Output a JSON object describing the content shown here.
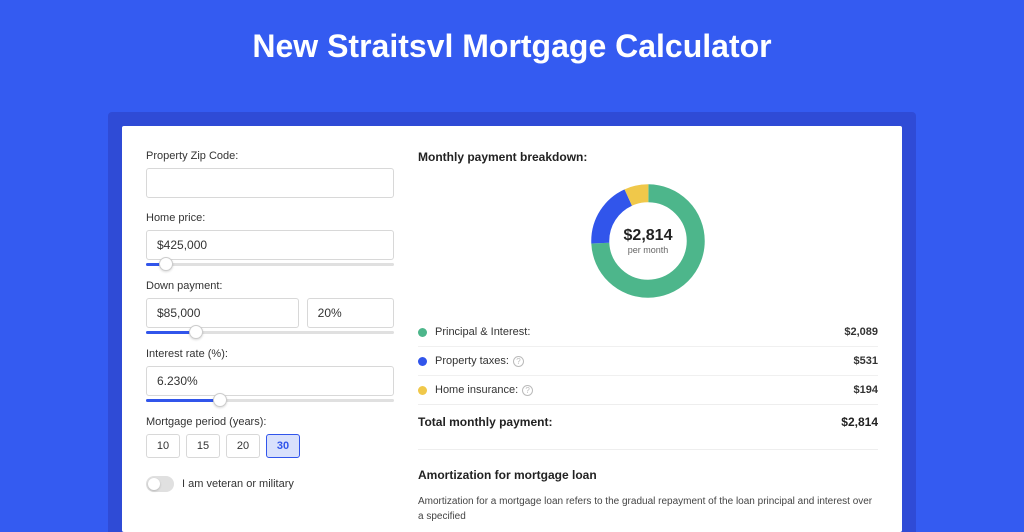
{
  "page_title": "New Straitsvl Mortgage Calculator",
  "form": {
    "zip_label": "Property Zip Code:",
    "zip_value": "",
    "home_price_label": "Home price:",
    "home_price_value": "$425,000",
    "home_price_slider_pct": 8,
    "down_payment_label": "Down payment:",
    "down_payment_value": "$85,000",
    "down_payment_pct_value": "20%",
    "down_payment_slider_pct": 20,
    "interest_label": "Interest rate (%):",
    "interest_value": "6.230%",
    "interest_slider_pct": 30,
    "period_label": "Mortgage period (years):",
    "periods": [
      "10",
      "15",
      "20",
      "30"
    ],
    "period_selected": "30",
    "veteran_label": "I am veteran or military"
  },
  "breakdown": {
    "title": "Monthly payment breakdown:",
    "donut_amount": "$2,814",
    "donut_sub": "per month",
    "items": [
      {
        "color": "#4db68b",
        "label": "Principal & Interest:",
        "value": "$2,089",
        "info": false,
        "share": 0.742
      },
      {
        "color": "#3155eb",
        "label": "Property taxes:",
        "value": "$531",
        "info": true,
        "share": 0.189
      },
      {
        "color": "#f0c84a",
        "label": "Home insurance:",
        "value": "$194",
        "info": true,
        "share": 0.069
      }
    ],
    "total_label": "Total monthly payment:",
    "total_value": "$2,814"
  },
  "amort": {
    "title": "Amortization for mortgage loan",
    "text": "Amortization for a mortgage loan refers to the gradual repayment of the loan principal and interest over a specified"
  },
  "chart_data": {
    "type": "pie",
    "title": "Monthly payment breakdown",
    "series": [
      {
        "name": "Principal & Interest",
        "value": 2089,
        "color": "#4db68b"
      },
      {
        "name": "Property taxes",
        "value": 531,
        "color": "#3155eb"
      },
      {
        "name": "Home insurance",
        "value": 194,
        "color": "#f0c84a"
      }
    ],
    "total": 2814,
    "center_label": "$2,814 per month"
  }
}
